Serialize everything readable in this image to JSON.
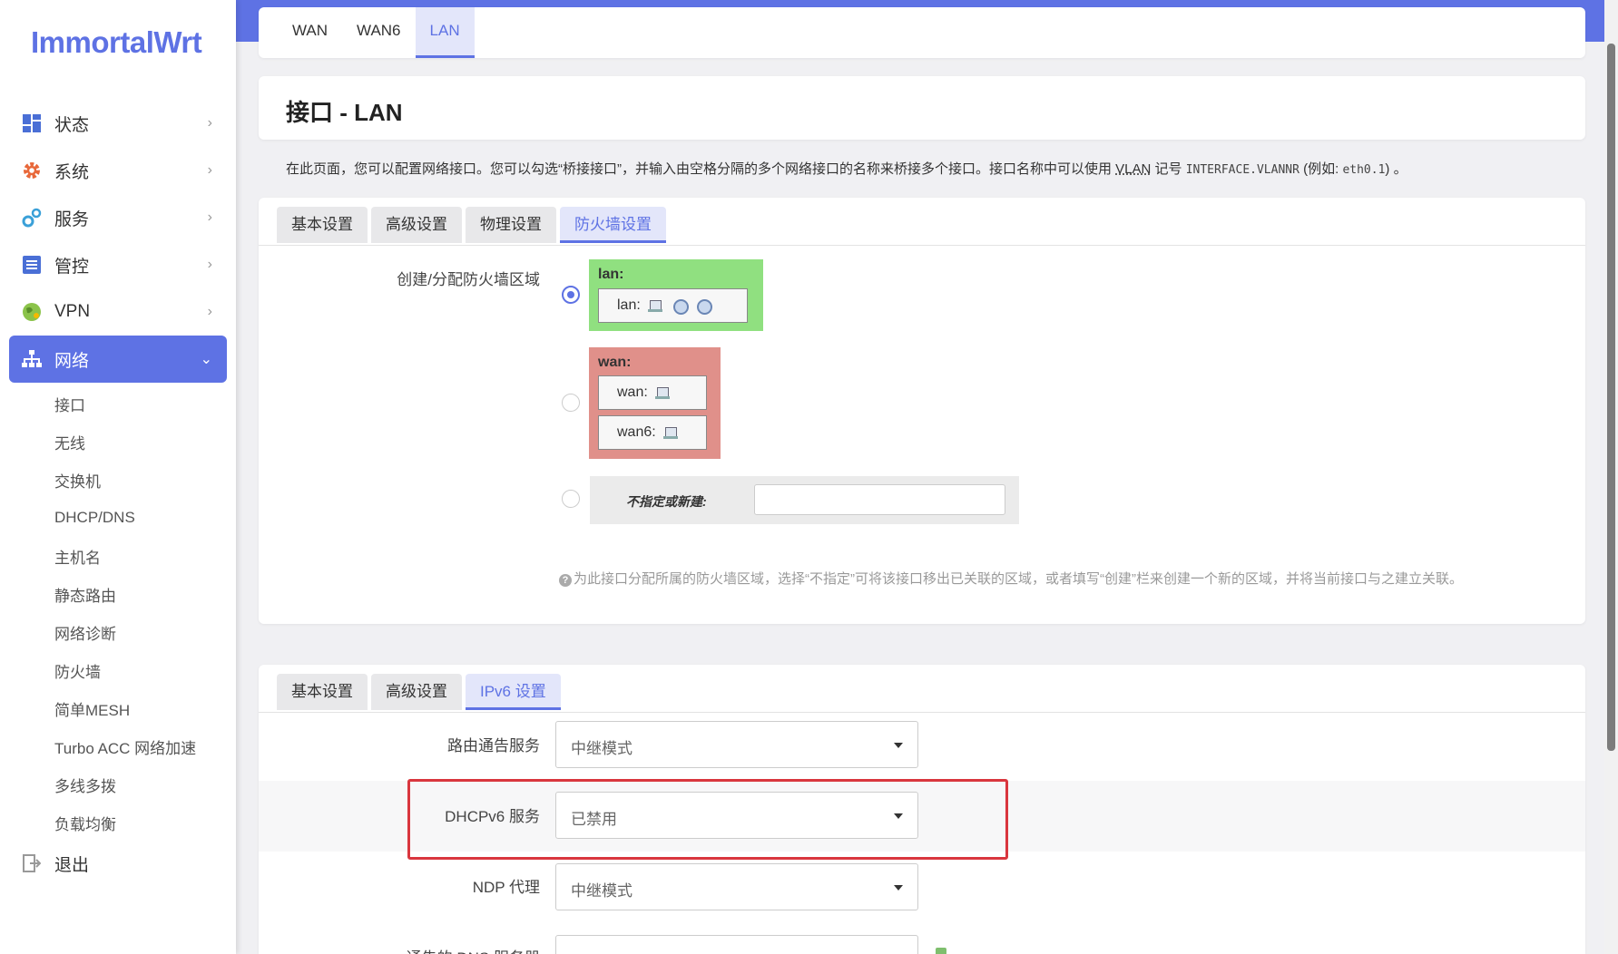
{
  "brand": {
    "logo": "ImmortalWrt"
  },
  "sidebar": {
    "items": [
      {
        "label": "状态",
        "icon": "dashboard-icon"
      },
      {
        "label": "系统",
        "icon": "gear-icon"
      },
      {
        "label": "服务",
        "icon": "services-icon"
      },
      {
        "label": "管控",
        "icon": "control-icon"
      },
      {
        "label": "VPN",
        "icon": "globe-icon"
      },
      {
        "label": "网络",
        "icon": "network-icon",
        "active": true
      }
    ],
    "network_submenu": [
      "接口",
      "无线",
      "交换机",
      "DHCP/DNS",
      "主机名",
      "静态路由",
      "网络诊断",
      "防火墙",
      "简单MESH",
      "Turbo ACC 网络加速",
      "多线多拨",
      "负载均衡"
    ],
    "logout": {
      "label": "退出",
      "icon": "logout-icon"
    }
  },
  "interface_tabs": [
    "WAN",
    "WAN6",
    "LAN"
  ],
  "interface_tab_active": "LAN",
  "page": {
    "title": "接口 - LAN",
    "desc_before": "在此页面，您可以配置网络接口。您可以勾选“桥接接口”，并输入由空格分隔的多个网络接口的名称来桥接多个接口。接口名称中可以使用 ",
    "desc_vlan": "VLAN",
    "desc_mid": " 记号 ",
    "desc_code1": "INTERFACE.VLANNR",
    "desc_mid2": " (例如: ",
    "desc_code2": "eth0.1",
    "desc_after": ") 。"
  },
  "config_tabs": [
    "基本设置",
    "高级设置",
    "物理设置",
    "防火墙设置"
  ],
  "config_tab_active": "防火墙设置",
  "firewall": {
    "label": "创建/分配防火墙区域",
    "zones": [
      {
        "name": "lan:",
        "color": "#90e080",
        "networks": [
          "lan:"
        ],
        "selected": true
      },
      {
        "name": "wan:",
        "color": "#e0908a",
        "networks": [
          "wan:",
          "wan6:"
        ],
        "selected": false
      }
    ],
    "new_zone_label": "不指定或新建:",
    "new_zone_value": "",
    "help": "为此接口分配所属的防火墙区域，选择“不指定”可将该接口移出已关联的区域，或者填写“创建”栏来创建一个新的区域，并将当前接口与之建立关联。"
  },
  "dhcp_tabs": [
    "基本设置",
    "高级设置",
    "IPv6 设置"
  ],
  "dhcp_tab_active": "IPv6 设置",
  "ipv6": {
    "ra_label": "路由通告服务",
    "ra_value": "中继模式",
    "dhcpv6_label": "DHCPv6 服务",
    "dhcpv6_value": "已禁用",
    "ndp_label": "NDP 代理",
    "ndp_value": "中继模式",
    "dns_label": "通告的 DNS 服务器"
  },
  "colors": {
    "accent": "#5e72e4",
    "highlight": "#d9363e",
    "lan_zone": "#90e080",
    "wan_zone": "#e0908a"
  }
}
